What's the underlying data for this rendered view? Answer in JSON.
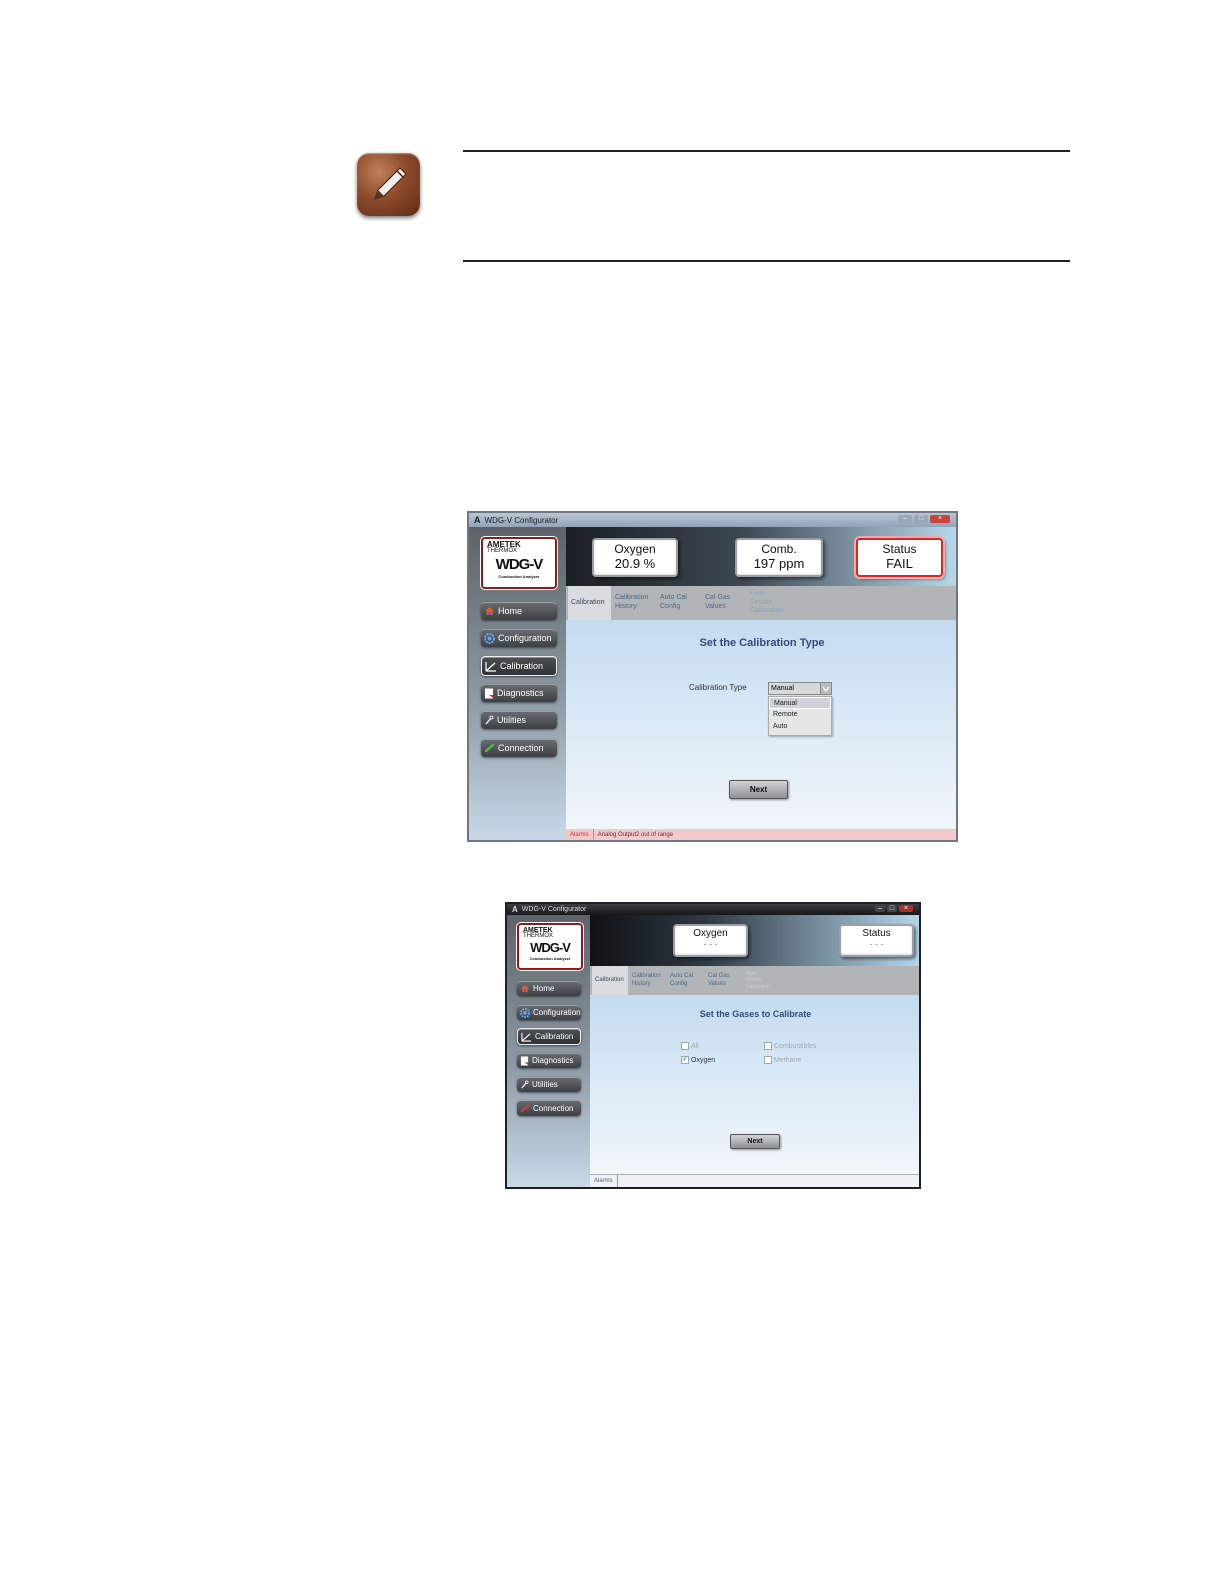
{
  "note": {
    "icon": "pencil-note-icon"
  },
  "screenshot1": {
    "window_title": "WDG-V Configurator",
    "logo": {
      "brand": "AMETEK",
      "sub": "THERMOX",
      "product": "WDG-V",
      "tagline": "Combustion Analyzer"
    },
    "nav": [
      {
        "label": "Home",
        "icon": "home-icon"
      },
      {
        "label": "Configuration",
        "icon": "gear-icon"
      },
      {
        "label": "Calibration",
        "icon": "calibration-icon"
      },
      {
        "label": "Diagnostics",
        "icon": "document-icon"
      },
      {
        "label": "Utilities",
        "icon": "wrench-icon"
      },
      {
        "label": "Connection",
        "icon": "link-icon"
      }
    ],
    "meters": [
      {
        "name": "Oxygen",
        "value": "20.9 %"
      },
      {
        "name": "Comb.",
        "value": "197 ppm"
      },
      {
        "name": "Status",
        "value": "FAIL"
      }
    ],
    "tabs": [
      {
        "line1": "Calibration",
        "line2": "",
        "line3": ""
      },
      {
        "line1": "Calibration",
        "line2": "History",
        "line3": ""
      },
      {
        "line1": "Auto Cal",
        "line2": "Config",
        "line3": ""
      },
      {
        "line1": "Cal Gas",
        "line2": "Values",
        "line3": ""
      },
      {
        "line1": "Flow",
        "line2": "Sensor",
        "line3": "Calibration"
      }
    ],
    "title": "Set the Calibration Type",
    "field_label": "Calibration Type",
    "select_value": "Manual",
    "options": [
      "Manual",
      "Remote",
      "Auto"
    ],
    "next_label": "Next",
    "alarms_label": "Alarms",
    "alarm_message": "Analog Output2 out of range",
    "colors": {
      "alarm_bar": "#f3c9c9",
      "status_border": "#d02a2a"
    }
  },
  "screenshot2": {
    "window_title": "WDG-V Configurator",
    "logo": {
      "brand": "AMETEK",
      "sub": "THERMOX",
      "product": "WDG-V",
      "tagline": "Combustion Analyzer"
    },
    "nav": [
      {
        "label": "Home",
        "icon": "home-icon"
      },
      {
        "label": "Configuration",
        "icon": "gear-icon"
      },
      {
        "label": "Calibration",
        "icon": "calibration-icon"
      },
      {
        "label": "Diagnostics",
        "icon": "document-icon"
      },
      {
        "label": "Utilities",
        "icon": "wrench-icon"
      },
      {
        "label": "Connection",
        "icon": "link-icon"
      }
    ],
    "meters": [
      {
        "name": "Oxygen",
        "value": "- - -"
      },
      {
        "name": "Status",
        "value": "- - -"
      }
    ],
    "tabs": [
      {
        "line1": "Calibration",
        "line2": "",
        "line3": ""
      },
      {
        "line1": "Calibration",
        "line2": "History",
        "line3": ""
      },
      {
        "line1": "Auto Cal",
        "line2": "Config",
        "line3": ""
      },
      {
        "line1": "Cal Gas",
        "line2": "Values",
        "line3": ""
      },
      {
        "line1": "Flow",
        "line2": "Sensor",
        "line3": "Calibration"
      }
    ],
    "title": "Set the Gases to Calibrate",
    "checkboxes": [
      {
        "label": "All",
        "checked": false,
        "enabled": false
      },
      {
        "label": "Combustibles",
        "checked": false,
        "enabled": false
      },
      {
        "label": "Oxygen",
        "checked": true,
        "enabled": true
      },
      {
        "label": "Methane",
        "checked": false,
        "enabled": false
      }
    ],
    "next_label": "Next",
    "alarms_label": "Alarms"
  }
}
